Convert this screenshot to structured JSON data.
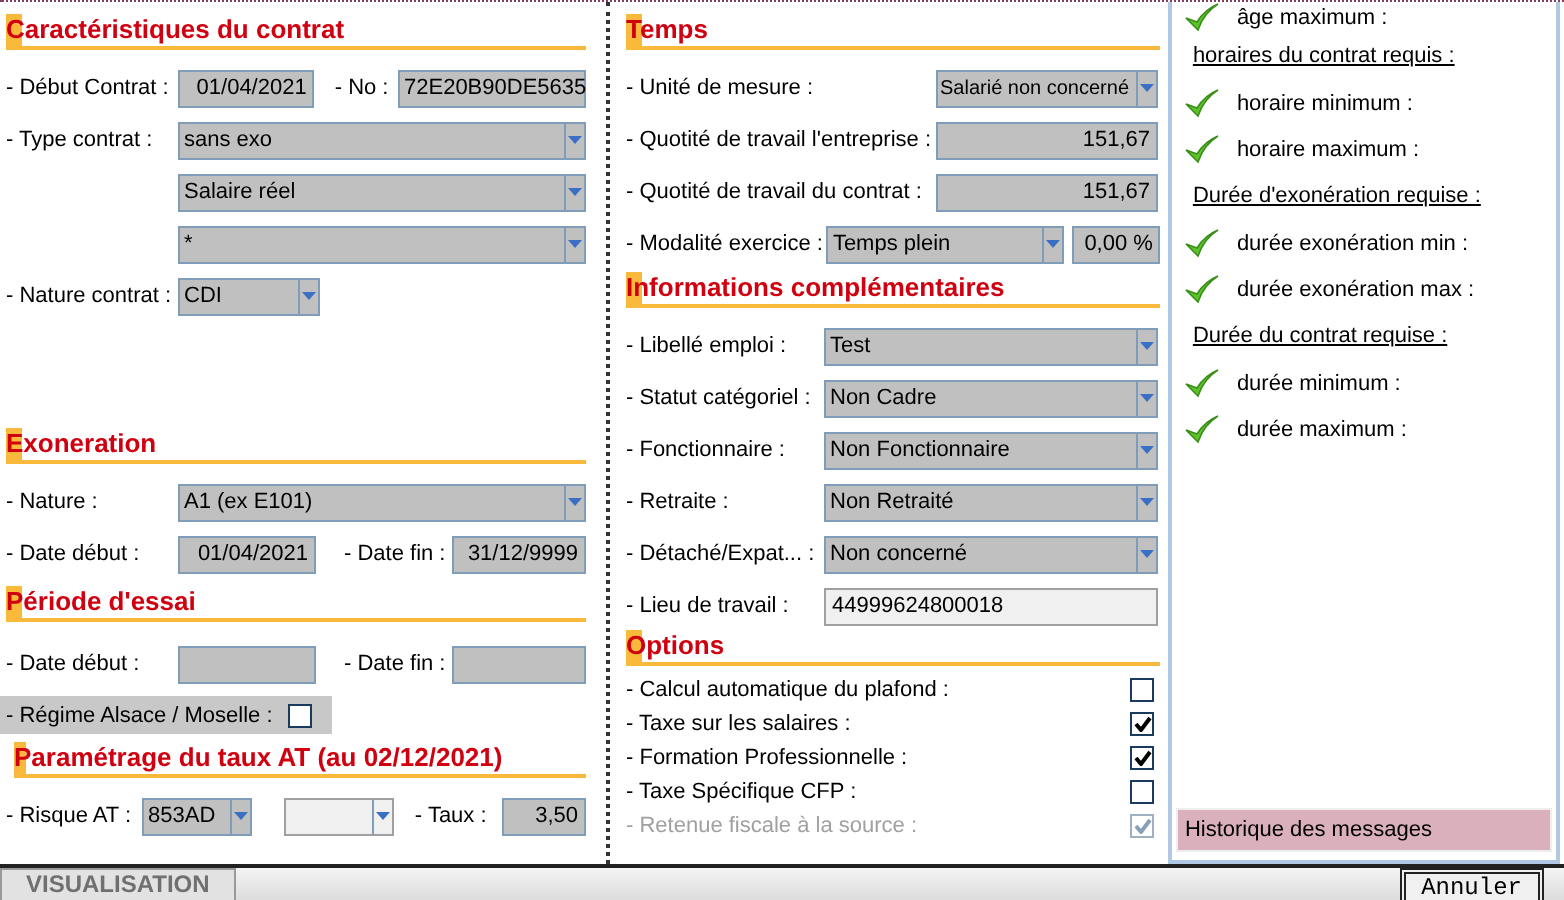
{
  "contract": {
    "title": "Caractéristiques du contrat",
    "start_label": "- Début Contrat :",
    "start_date": "01/04/2021",
    "no_label": "- No :",
    "no_value": "72E20B90DE5635",
    "type_label": "- Type contrat :",
    "type_values": [
      "sans exo",
      "Salaire réel",
      "*"
    ],
    "nature_label": "- Nature contrat :",
    "nature_value": "CDI"
  },
  "exoneration": {
    "title": "Exoneration",
    "nature_label": "- Nature :",
    "nature_value": "A1 (ex E101)",
    "start_label": "- Date début :",
    "start_date": "01/04/2021",
    "end_label": "- Date fin :",
    "end_date": "31/12/9999"
  },
  "trial": {
    "title": "Période d'essai",
    "start_label": "- Date début :",
    "end_label": "- Date fin :",
    "alsace_label": "- Régime Alsace / Moselle :",
    "alsace_checked": false
  },
  "at_rate": {
    "title": "Paramétrage du taux AT (au 02/12/2021)",
    "risk_label": "- Risque AT :",
    "risk_value": "853AD",
    "rate_label": "- Taux :",
    "rate_value": "3,50"
  },
  "time": {
    "title": "Temps",
    "unit_label": "- Unité de mesure :",
    "unit_value": "Salarié non concerné",
    "company_label": "- Quotité de travail l'entreprise :",
    "company_value": "151,67",
    "contract_label": "- Quotité de travail du contrat :",
    "contract_value": "151,67",
    "mode_label": "- Modalité exercice :",
    "mode_value": "Temps plein",
    "mode_percent": "0,00 %"
  },
  "info": {
    "title": "Informations complémentaires",
    "rows": [
      {
        "kind": "dropdown",
        "label": "- Libellé emploi :",
        "value": "Test"
      },
      {
        "kind": "dropdown",
        "label": "- Statut catégoriel :",
        "value": "Non Cadre"
      },
      {
        "kind": "dropdown",
        "label": "- Fonctionnaire :",
        "value": "Non Fonctionnaire"
      },
      {
        "kind": "dropdown",
        "label": "- Retraite :",
        "value": "Non Retraité"
      },
      {
        "kind": "dropdown",
        "label": "- Détaché/Expat... :",
        "value": "Non concerné"
      },
      {
        "kind": "text",
        "label": "- Lieu de travail :",
        "value": "44999624800018"
      }
    ]
  },
  "options": {
    "title": "Options",
    "rows": [
      {
        "label": "- Calcul automatique du plafond  :",
        "checked": false,
        "disabled": false
      },
      {
        "label": "- Taxe sur les salaires :",
        "checked": true,
        "disabled": false
      },
      {
        "label": "- Formation Professionnelle :",
        "checked": true,
        "disabled": false
      },
      {
        "label": "- Taxe Spécifique CFP :",
        "checked": false,
        "disabled": false
      },
      {
        "label": "- Retenue fiscale à la source :",
        "checked": true,
        "disabled": true
      }
    ]
  },
  "checks_panel": {
    "items": [
      {
        "kind": "check",
        "label": "âge maximum :"
      },
      {
        "kind": "heading",
        "label": "horaires du contrat requis :"
      },
      {
        "kind": "check",
        "label": "horaire minimum :"
      },
      {
        "kind": "check",
        "label": "horaire maximum :"
      },
      {
        "kind": "heading",
        "label": "Durée d'exonération requise :"
      },
      {
        "kind": "check",
        "label": "durée exonération min :"
      },
      {
        "kind": "check",
        "label": "durée exonération max :"
      },
      {
        "kind": "heading",
        "label": "Durée du contrat requise :"
      },
      {
        "kind": "check",
        "label": "durée minimum :"
      },
      {
        "kind": "check",
        "label": "durée maximum :"
      }
    ],
    "history": "Historique des messages"
  },
  "bottom_bar": {
    "tab": "VISUALISATION",
    "cancel_button": "Annuler"
  }
}
